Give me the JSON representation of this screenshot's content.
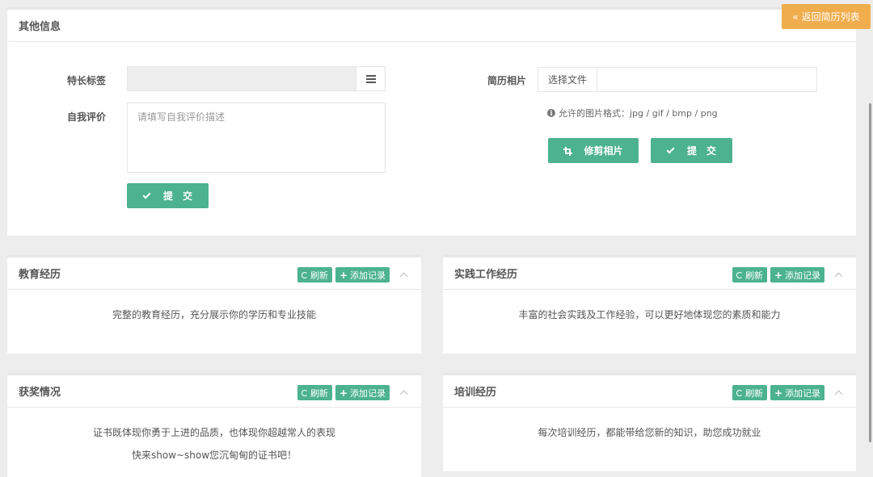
{
  "top": {
    "title": "其他信息",
    "back_label": "« 返回简历列表",
    "tag_label": "特长标签",
    "self_eval_label": "自我评价",
    "self_eval_placeholder": "请填写自我评价描述",
    "submit_label": "提　交",
    "photo_label": "简历相片",
    "file_button_label": "选择文件",
    "photo_hint": "允许的图片格式：jpg / gif / bmp / png",
    "crop_label": "修剪相片",
    "photo_submit_label": "提　交"
  },
  "panel_tools": {
    "refresh_label": "刷新",
    "add_label": "添加记录"
  },
  "panels": {
    "education": {
      "title": "教育经历",
      "lines": [
        "完整的教育经历，充分展示你的学历和专业技能"
      ]
    },
    "practice": {
      "title": "实践工作经历",
      "lines": [
        "丰富的社会实践及工作经验，可以更好地体现您的素质和能力"
      ]
    },
    "awards": {
      "title": "获奖情况",
      "lines": [
        "证书既体现你勇于上进的品质，也体现你超越常人的表现",
        "快来show~show您沉甸甸的证书吧！"
      ]
    },
    "training": {
      "title": "培训经历",
      "lines": [
        "每次培训经历，都能带给您新的知识，助您成功就业"
      ]
    }
  },
  "colors": {
    "green": "#4cb28f",
    "orange": "#f0ad4e"
  }
}
